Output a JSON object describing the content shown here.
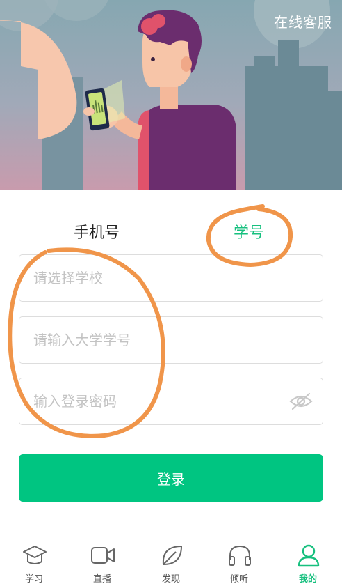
{
  "header": {
    "service_label": "在线客服"
  },
  "tabs": [
    {
      "label": "手机号",
      "active": false
    },
    {
      "label": "学号",
      "active": true
    }
  ],
  "form": {
    "school_placeholder": "请选择学校",
    "student_id_placeholder": "请输入大学学号",
    "password_placeholder": "输入登录密码",
    "login_label": "登录"
  },
  "bottom_nav": [
    {
      "label": "学习",
      "icon": "graduation-cap-icon",
      "active": false
    },
    {
      "label": "直播",
      "icon": "video-camera-icon",
      "active": false
    },
    {
      "label": "发现",
      "icon": "leaf-icon",
      "active": false
    },
    {
      "label": "倾听",
      "icon": "headphones-icon",
      "active": false
    },
    {
      "label": "我的",
      "icon": "user-icon",
      "active": true
    }
  ],
  "colors": {
    "accent": "#00c581",
    "accent_text": "#17c07f",
    "annotation": "#f0954a",
    "hero_top": "#8ba7b0",
    "hero_bottom": "#c79aad"
  }
}
